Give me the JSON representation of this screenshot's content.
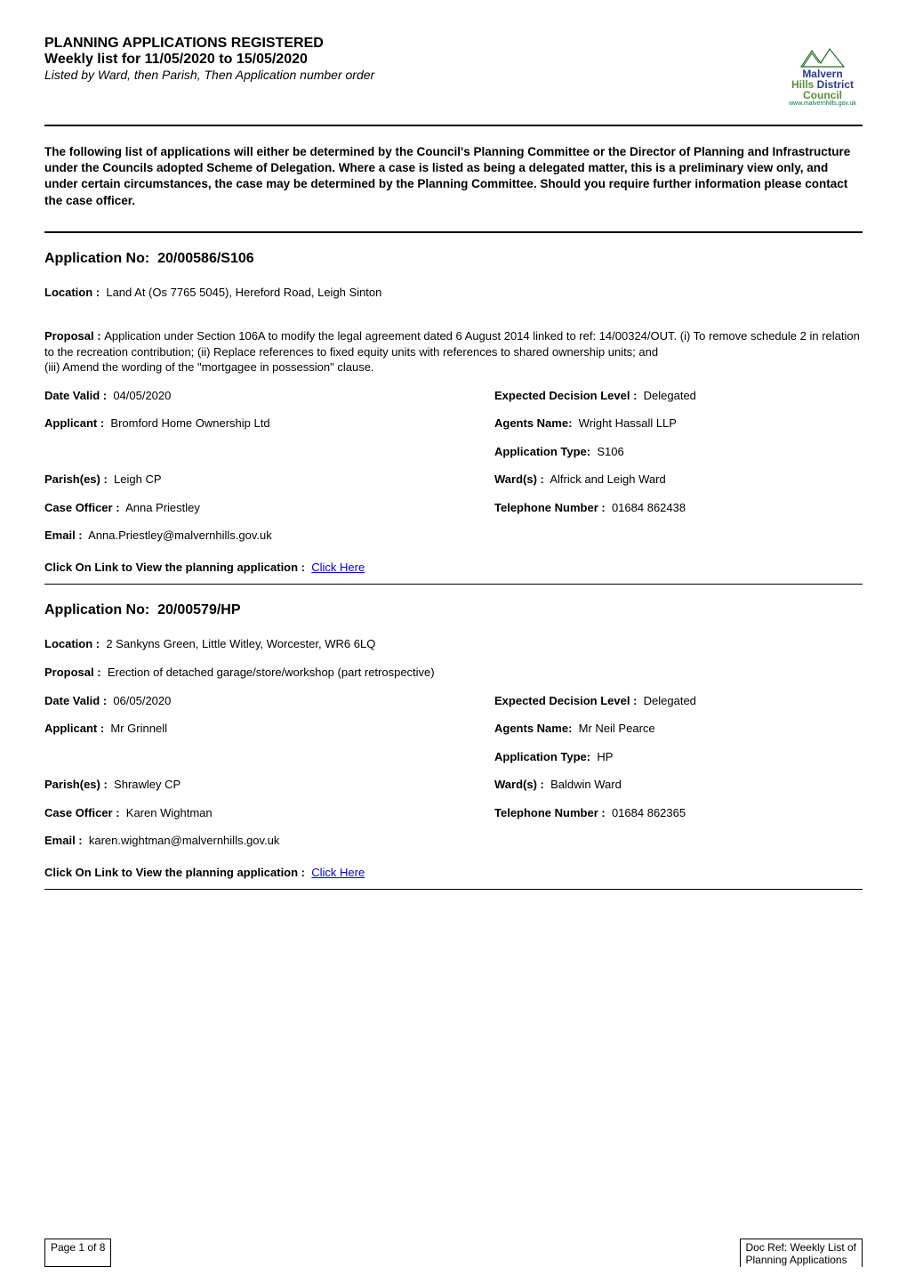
{
  "header": {
    "title1": "PLANNING APPLICATIONS REGISTERED",
    "title2": "Weekly list for 11/05/2020 to 15/05/2020",
    "subtitle": "Listed by Ward, then Parish, Then Application number order",
    "logo": {
      "line1a": "Malvern",
      "line1b": "Hills",
      "line2a": "District",
      "line2b": "Council",
      "url": "www.malvernhills.gov.uk"
    }
  },
  "intro": "The following list of applications will either be determined by the Council's Planning Committee or the Director of Planning and Infrastructure under the Councils adopted Scheme of Delegation.  Where a case is listed as being a delegated matter, this is a preliminary view only, and under certain circumstances, the case may be determined by the Planning Committee.  Should you require further information please contact the case officer.",
  "applications": [
    {
      "app_no_label": "Application No:",
      "app_no": "20/00586/S106",
      "location_label": "Location :",
      "location": "Land At (Os 7765 5045), Hereford Road, Leigh Sinton",
      "proposal_label": "Proposal :",
      "proposal": "Application under Section 106A to modify the legal agreement dated 6 August 2014 linked to ref: 14/00324/OUT. (i) To remove schedule 2 in relation to the recreation contribution; (ii) Replace references to fixed equity units with references to shared ownership units; and\n(iii) Amend the wording of the \"mortgagee in possession\" clause.",
      "date_valid_label": "Date Valid :",
      "date_valid": "04/05/2020",
      "expected_label": "Expected Decision Level :",
      "expected": "Delegated",
      "applicant_label": "Applicant :",
      "applicant": "Bromford Home Ownership Ltd",
      "agents_label": "Agents Name:",
      "agents": "Wright Hassall LLP",
      "app_type_label": "Application Type:",
      "app_type": "S106",
      "parish_label": "Parish(es) :",
      "parish": "Leigh CP",
      "ward_label": "Ward(s) :",
      "ward": "Alfrick and Leigh Ward",
      "officer_label": "Case Officer :",
      "officer": "Anna Priestley",
      "tel_label": "Telephone Number :",
      "tel": "01684 862438",
      "email_label": "Email :",
      "email": "Anna.Priestley@malvernhills.gov.uk",
      "click_label": "Click On Link to View the planning application :",
      "click_link": "Click Here"
    },
    {
      "app_no_label": "Application No:",
      "app_no": "20/00579/HP",
      "location_label": "Location :",
      "location": "2 Sankyns Green, Little Witley, Worcester, WR6 6LQ",
      "proposal_label": "Proposal :",
      "proposal": "Erection of detached garage/store/workshop (part retrospective)",
      "date_valid_label": "Date Valid :",
      "date_valid": "06/05/2020",
      "expected_label": "Expected Decision Level :",
      "expected": "Delegated",
      "applicant_label": "Applicant :",
      "applicant": "Mr Grinnell",
      "agents_label": "Agents Name:",
      "agents": "Mr Neil Pearce",
      "app_type_label": "Application Type:",
      "app_type": "HP",
      "parish_label": "Parish(es) :",
      "parish": "Shrawley CP",
      "ward_label": "Ward(s) :",
      "ward": "Baldwin Ward",
      "officer_label": "Case Officer :",
      "officer": "Karen Wightman",
      "tel_label": "Telephone Number :",
      "tel": "01684 862365",
      "email_label": "Email :",
      "email": "karen.wightman@malvernhills.gov.uk",
      "click_label": "Click On Link to View the planning application :",
      "click_link": "Click Here"
    }
  ],
  "footer": {
    "page": "Page 1 of 8",
    "docref1": "Doc Ref: Weekly List of",
    "docref2": "Planning Applications"
  }
}
